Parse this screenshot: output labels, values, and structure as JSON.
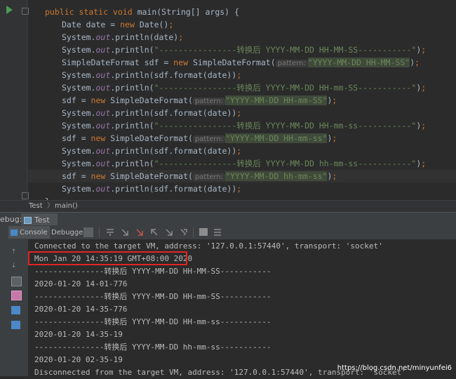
{
  "editor": {
    "lines": [
      [
        {
          "t": "public static void ",
          "c": "kw"
        },
        {
          "t": "main(String[] args) {",
          "c": ""
        }
      ],
      [
        {
          "t": "Date date = ",
          "c": ""
        },
        {
          "t": "new ",
          "c": "kw"
        },
        {
          "t": "Date()",
          "c": ""
        },
        {
          "t": ";",
          "c": "kw"
        }
      ],
      [
        {
          "t": "System.",
          "c": ""
        },
        {
          "t": "out",
          "c": "it"
        },
        {
          "t": ".println(date)",
          "c": ""
        },
        {
          "t": ";",
          "c": "kw"
        }
      ],
      [
        {
          "t": "System.",
          "c": ""
        },
        {
          "t": "out",
          "c": "it"
        },
        {
          "t": ".println(",
          "c": ""
        },
        {
          "t": "\"----------------转换后 YYYY-MM-DD HH-MM-SS-----------\"",
          "c": "str"
        },
        {
          "t": ")",
          "c": ""
        },
        {
          "t": ";",
          "c": "kw"
        }
      ],
      [
        {
          "t": "SimpleDateFormat sdf = ",
          "c": ""
        },
        {
          "t": "new ",
          "c": "kw"
        },
        {
          "t": "SimpleDateFormat(",
          "c": ""
        },
        {
          "t": "pattern:",
          "c": "hint"
        },
        {
          "t": "\"YYYY-MM-DD HH-MM-SS\"",
          "c": "strhl"
        },
        {
          "t": ")",
          "c": ""
        },
        {
          "t": ";",
          "c": "kw"
        }
      ],
      [
        {
          "t": "System.",
          "c": ""
        },
        {
          "t": "out",
          "c": "it"
        },
        {
          "t": ".println(sdf.format(date))",
          "c": ""
        },
        {
          "t": ";",
          "c": "kw"
        }
      ],
      [
        {
          "t": "System.",
          "c": ""
        },
        {
          "t": "out",
          "c": "it"
        },
        {
          "t": ".println(",
          "c": ""
        },
        {
          "t": "\"----------------转换后 YYYY-MM-DD HH-mm-SS-----------\"",
          "c": "str"
        },
        {
          "t": ")",
          "c": ""
        },
        {
          "t": ";",
          "c": "kw"
        }
      ],
      [
        {
          "t": "sdf = ",
          "c": ""
        },
        {
          "t": "new ",
          "c": "kw"
        },
        {
          "t": "SimpleDateFormat(",
          "c": ""
        },
        {
          "t": "pattern:",
          "c": "hint"
        },
        {
          "t": "\"YYYY-MM-DD HH-mm-SS\"",
          "c": "strhl"
        },
        {
          "t": ")",
          "c": ""
        },
        {
          "t": ";",
          "c": "kw"
        }
      ],
      [
        {
          "t": "System.",
          "c": ""
        },
        {
          "t": "out",
          "c": "it"
        },
        {
          "t": ".println(sdf.format(date))",
          "c": ""
        },
        {
          "t": ";",
          "c": "kw"
        }
      ],
      [
        {
          "t": "System.",
          "c": ""
        },
        {
          "t": "out",
          "c": "it"
        },
        {
          "t": ".println(",
          "c": ""
        },
        {
          "t": "\"----------------转换后 YYYY-MM-DD HH-mm-ss-----------\"",
          "c": "str"
        },
        {
          "t": ")",
          "c": ""
        },
        {
          "t": ";",
          "c": "kw"
        }
      ],
      [
        {
          "t": "sdf = ",
          "c": ""
        },
        {
          "t": "new ",
          "c": "kw"
        },
        {
          "t": "SimpleDateFormat(",
          "c": ""
        },
        {
          "t": "pattern:",
          "c": "hint"
        },
        {
          "t": "\"YYYY-MM-DD HH-mm-ss\"",
          "c": "strhl"
        },
        {
          "t": ")",
          "c": ""
        },
        {
          "t": ";",
          "c": "kw"
        }
      ],
      [
        {
          "t": "System.",
          "c": ""
        },
        {
          "t": "out",
          "c": "it"
        },
        {
          "t": ".println(sdf.format(date))",
          "c": ""
        },
        {
          "t": ";",
          "c": "kw"
        }
      ],
      [
        {
          "t": "System.",
          "c": ""
        },
        {
          "t": "out",
          "c": "it"
        },
        {
          "t": ".println(",
          "c": ""
        },
        {
          "t": "\"----------------转换后 YYYY-MM-DD hh-mm-ss-----------\"",
          "c": "str"
        },
        {
          "t": ")",
          "c": ""
        },
        {
          "t": ";",
          "c": "kw"
        }
      ],
      [
        {
          "t": "sdf = ",
          "c": ""
        },
        {
          "t": "new ",
          "c": "kw"
        },
        {
          "t": "SimpleDateFormat(",
          "c": ""
        },
        {
          "t": "pattern:",
          "c": "hint"
        },
        {
          "t": "\"YYYY-MM-DD hh-mm-ss\"",
          "c": "strhl"
        },
        {
          "t": ")",
          "c": ""
        },
        {
          "t": ";",
          "c": "kw"
        }
      ],
      [
        {
          "t": "System.",
          "c": ""
        },
        {
          "t": "out",
          "c": "it"
        },
        {
          "t": ".println(sdf.format(date))",
          "c": ""
        },
        {
          "t": ";",
          "c": "kw"
        }
      ],
      [
        {
          "t": "}",
          "c": ""
        }
      ]
    ]
  },
  "breadcrumbs": {
    "class_name": "Test",
    "method_name": "main()"
  },
  "debug_bar": {
    "label": "ebug:",
    "tab_label": "Test"
  },
  "toolbar": {
    "console_label": "Console",
    "debugger_label": "Debugger"
  },
  "console": {
    "lines": [
      "Connected to the target VM, address: '127.0.0.1:57440', transport: 'socket'",
      "Mon Jan 20 14:35:19 GMT+08:00 2020",
      "---------------转换后 YYYY-MM-DD HH-MM-SS-----------",
      "2020-01-20 14-01-776",
      "---------------转换后 YYYY-MM-DD HH-mm-SS-----------",
      "2020-01-20 14-35-776",
      "---------------转换后 YYYY-MM-DD HH-mm-ss-----------",
      "2020-01-20 14-35-19",
      "---------------转换后 YYYY-MM-DD hh-mm-ss-----------",
      "2020-01-20 02-35-19",
      "Disconnected from the target VM, address: '127.0.0.1:57440', transport: 'socket'"
    ]
  },
  "watermark": "https://blog.csdn.net/minyunfei6"
}
